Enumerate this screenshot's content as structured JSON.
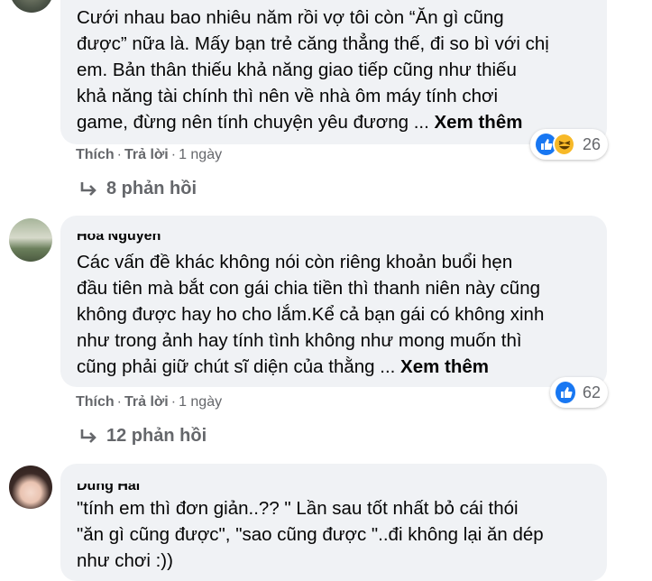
{
  "comments": [
    {
      "author": "",
      "lines": [
        "Cưới nhau bao nhiêu năm rồi vợ tôi còn “Ăn gì cũng",
        "được” nữa là. Mấy bạn trẻ căng thẳng thế, đi so bì với chị",
        "em. Bản thân thiếu khả năng giao tiếp cũng như thiếu",
        "khả năng tài chính thì nên về nhà ôm máy tính chơi",
        "game, đừng nên tính chuyện yêu đương ... "
      ],
      "see_more": "Xem thêm",
      "like": "Thích",
      "reply": "Trả lời",
      "time": "1 ngày",
      "reaction_icons": [
        "like-icon",
        "haha-icon"
      ],
      "reaction_count": "26",
      "replies": "8 phản hồi"
    },
    {
      "author": "Hoa Nguyễn",
      "lines": [
        "Các vấn đề khác không nói còn riêng khoản buổi hẹn",
        "đầu tiên mà bắt con gái chia tiền thì thanh niên này cũng",
        "không được hay ho cho lắm.Kể cả bạn gái có không xinh",
        "như trong ảnh hay tính tình không như mong muốn thì",
        "cũng phải giữ chút sĩ diện của thằng ... "
      ],
      "see_more": "Xem thêm",
      "like": "Thích",
      "reply": "Trả lời",
      "time": "1 ngày",
      "reaction_icons": [
        "like-icon"
      ],
      "reaction_count": "62",
      "replies": "12 phản hồi"
    },
    {
      "author": "Dung Hải",
      "lines": [
        "\"tính em thì đơn giản..?? \" Lần sau tốt nhất bỏ cái thói",
        "\"ăn gì cũng được\", \"sao cũng được \"..đi không lại ăn dép",
        "như chơi :))"
      ]
    }
  ],
  "separator": "·",
  "colors": {
    "bubble": "#f0f2f5",
    "meta": "#65676b",
    "like_blue": "#1877f2",
    "haha_yellow": "#f7b928"
  }
}
